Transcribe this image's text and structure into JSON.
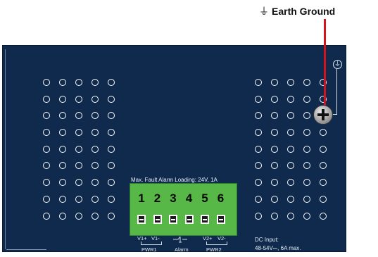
{
  "callout": {
    "label": "Earth Ground",
    "icon": "earth-ground-icon",
    "symbol": "⏚",
    "pointer_color": "#d4141c"
  },
  "panel": {
    "color": "#0f2a4d",
    "vents_left": {
      "rows": 9,
      "cols": 5
    },
    "vents_right": {
      "rows": 9,
      "cols": 5
    }
  },
  "terminal": {
    "caption": "Max. Fault Alarm Loading: 24V, 1A",
    "numbers": [
      "1",
      "2",
      "3",
      "4",
      "5",
      "6"
    ],
    "pins": [
      "V1+",
      "V1-",
      "V2+",
      "V2-"
    ],
    "pwr1": "PWR1",
    "alarm": "Alarm",
    "pwr2": "PWR2",
    "color": "#58b847"
  },
  "dc_input": {
    "line1": "DC Input:",
    "line2": "48-54V⎓, 6A max."
  }
}
